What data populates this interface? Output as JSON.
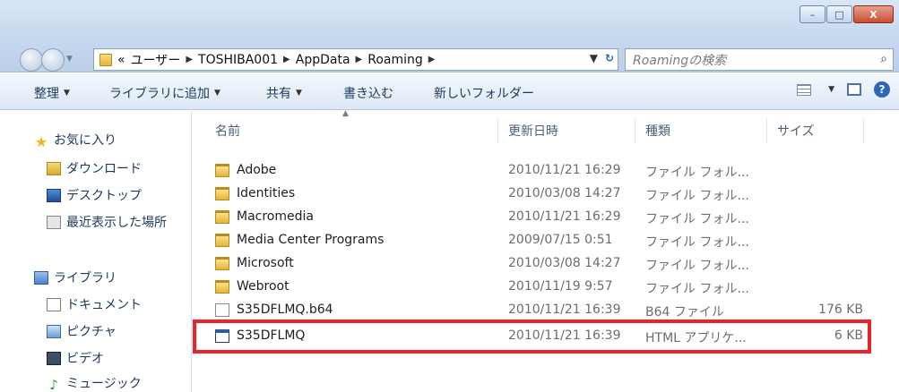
{
  "window": {
    "min_label": "–",
    "max_label": "□",
    "close_label": "X"
  },
  "address": {
    "overflow": "«",
    "crumbs": [
      "ユーザー",
      "TOSHIBA001",
      "AppData",
      "Roaming"
    ],
    "search_placeholder": "Roamingの検索"
  },
  "toolbar": {
    "organize": "整理",
    "add_library": "ライブラリに追加",
    "share": "共有",
    "burn": "書き込む",
    "new_folder": "新しいフォルダー"
  },
  "sidebar": {
    "favorites": "お気に入り",
    "downloads": "ダウンロード",
    "desktop": "デスクトップ",
    "recent": "最近表示した場所",
    "libraries": "ライブラリ",
    "documents": "ドキュメント",
    "pictures": "ピクチャ",
    "videos": "ビデオ",
    "music": "ミュージック"
  },
  "columns": {
    "name": "名前",
    "date": "更新日時",
    "type": "種類",
    "size": "サイズ"
  },
  "files": [
    {
      "name": "Adobe",
      "date": "2010/11/21 16:29",
      "type": "ファイル フォル...",
      "size": "",
      "kind": "folder"
    },
    {
      "name": "Identities",
      "date": "2010/03/08 14:27",
      "type": "ファイル フォル...",
      "size": "",
      "kind": "folder"
    },
    {
      "name": "Macromedia",
      "date": "2010/11/21 16:29",
      "type": "ファイル フォル...",
      "size": "",
      "kind": "folder"
    },
    {
      "name": "Media Center Programs",
      "date": "2009/07/15 0:51",
      "type": "ファイル フォル...",
      "size": "",
      "kind": "folder"
    },
    {
      "name": "Microsoft",
      "date": "2010/03/08 14:27",
      "type": "ファイル フォル...",
      "size": "",
      "kind": "folder"
    },
    {
      "name": "Webroot",
      "date": "2010/11/19 9:57",
      "type": "ファイル フォル...",
      "size": "",
      "kind": "folder"
    },
    {
      "name": "S35DFLMQ.b64",
      "date": "2010/11/21 16:39",
      "type": "B64 ファイル",
      "size": "176 KB",
      "kind": "file"
    },
    {
      "name": "S35DFLMQ",
      "date": "2010/11/21 16:39",
      "type": "HTML アプリケ...",
      "size": "6 KB",
      "kind": "hta"
    }
  ],
  "colors": {
    "highlight": "#e8242a",
    "chrome": "#c9daef"
  }
}
